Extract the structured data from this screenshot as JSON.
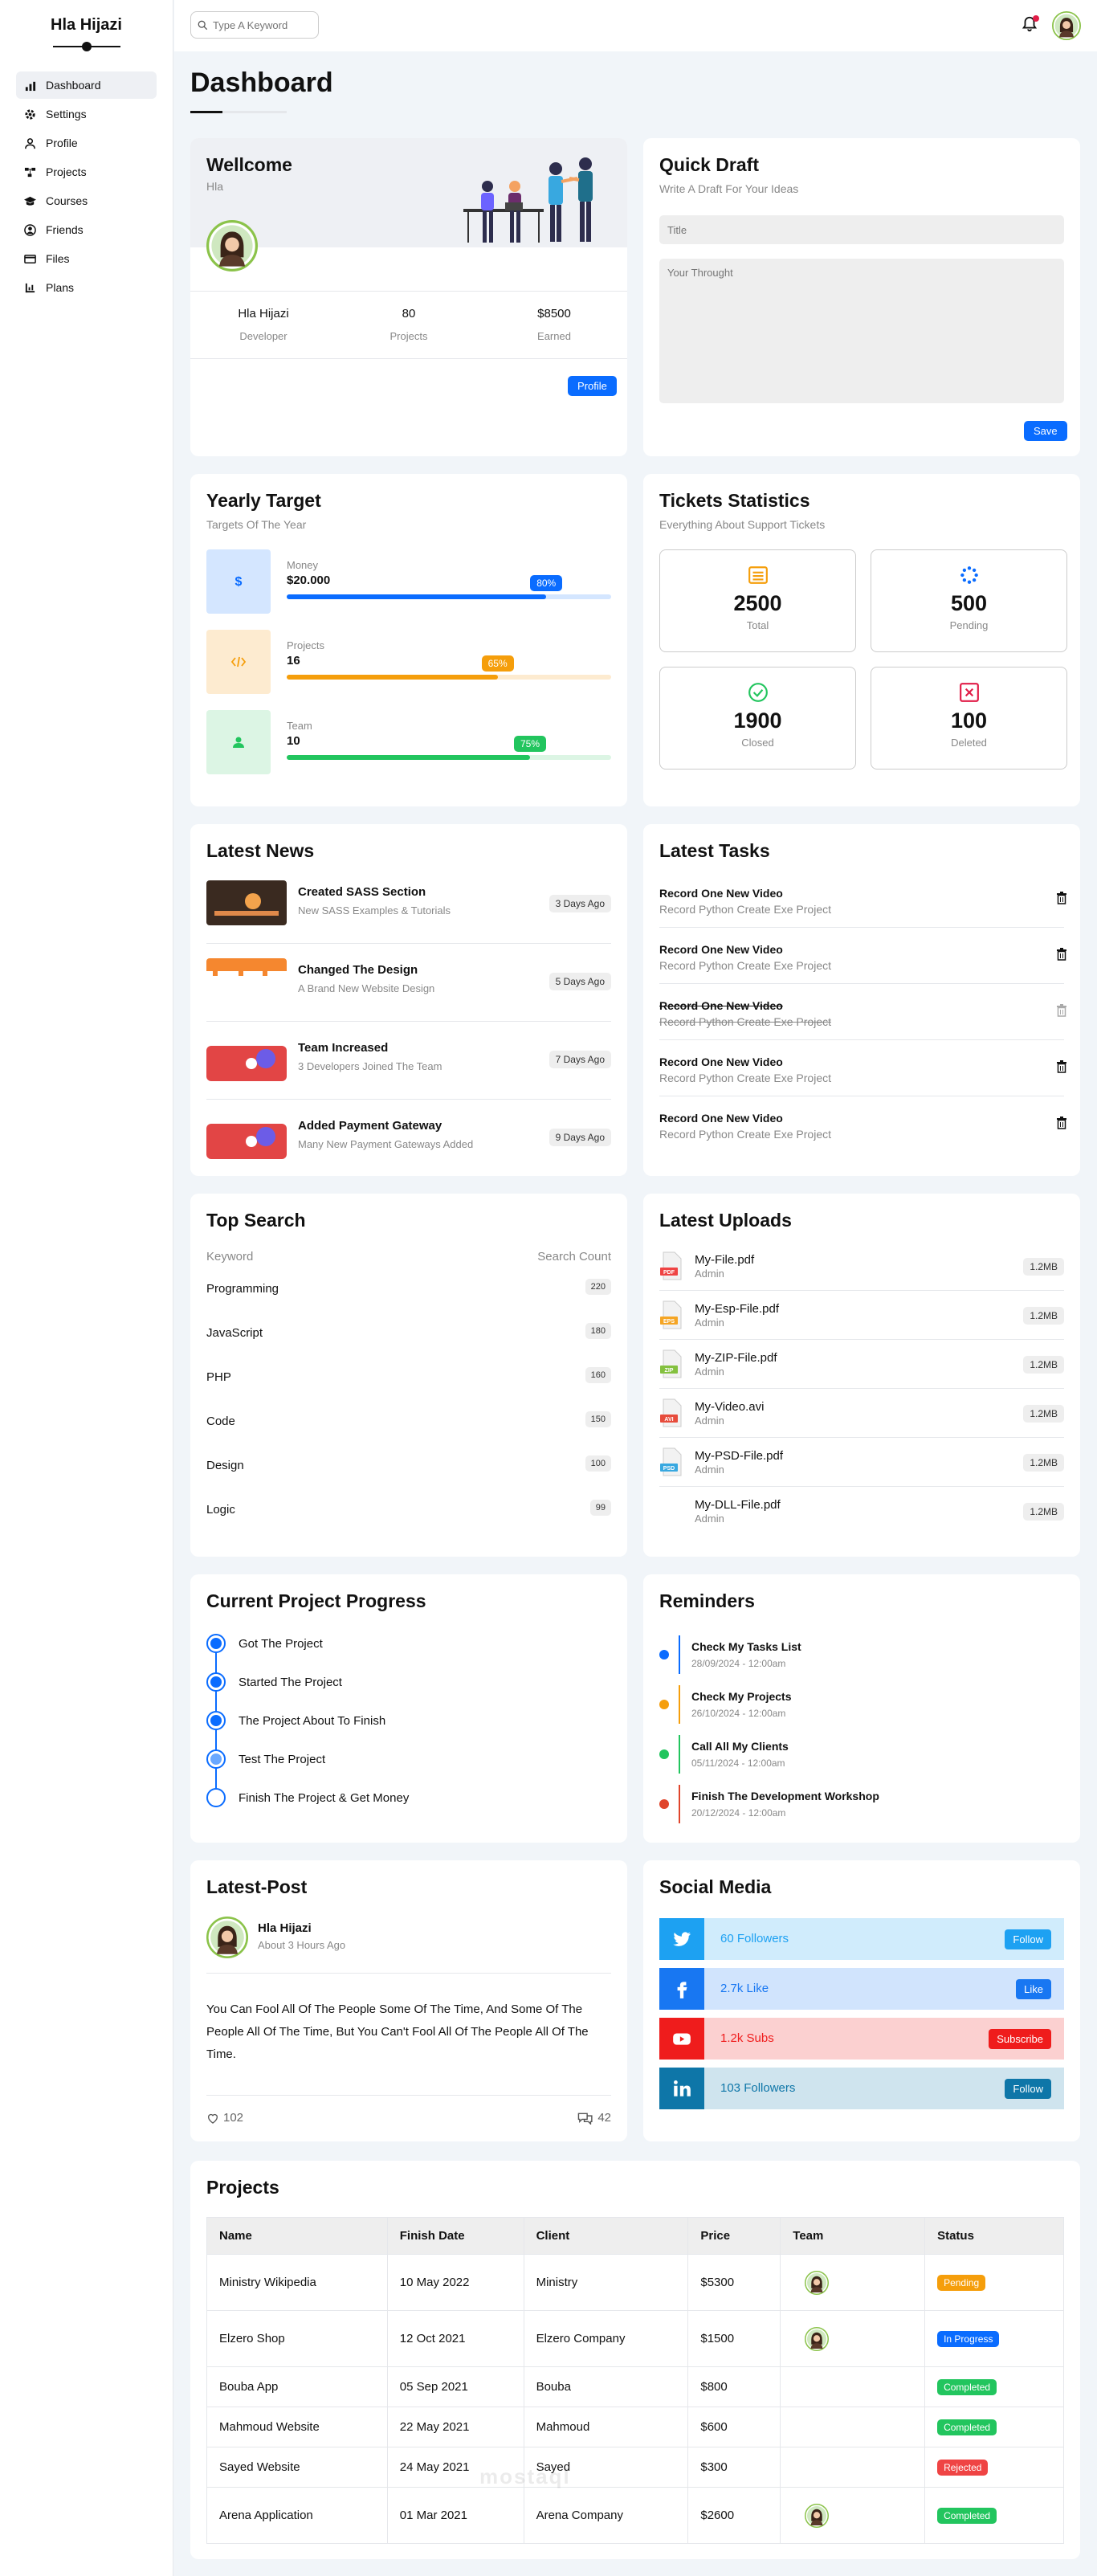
{
  "sidebar": {
    "brand": "Hla Hijazi",
    "items": [
      {
        "label": "Dashboard",
        "icon": "chart-icon",
        "active": true
      },
      {
        "label": "Settings",
        "icon": "gear-icon"
      },
      {
        "label": "Profile",
        "icon": "user-icon"
      },
      {
        "label": "Projects",
        "icon": "diagram-icon"
      },
      {
        "label": "Courses",
        "icon": "graduation-cap-icon"
      },
      {
        "label": "Friends",
        "icon": "user-circle-icon"
      },
      {
        "label": "Files",
        "icon": "file-icon"
      },
      {
        "label": "Plans",
        "icon": "plans-icon"
      }
    ]
  },
  "topbar": {
    "search_placeholder": "Type A Keyword"
  },
  "page": {
    "title": "Dashboard"
  },
  "welcome": {
    "title": "Wellcome",
    "name": "Hla",
    "stats": [
      {
        "value": "Hla Hijazi",
        "label": "Developer"
      },
      {
        "value": "80",
        "label": "Projects"
      },
      {
        "value": "$8500",
        "label": "Earned"
      }
    ],
    "button": "Profile"
  },
  "quick_draft": {
    "title": "Quick Draft",
    "subtitle": "Write A Draft For Your Ideas",
    "title_placeholder": "Title",
    "body_placeholder": "Your Throught",
    "button": "Save"
  },
  "yearly_target": {
    "title": "Yearly Target",
    "subtitle": "Targets Of The Year",
    "items": [
      {
        "label": "Money",
        "value": "$20.000",
        "percent_label": "80%",
        "percent": 80,
        "color": "#0a6cff",
        "bg": "#d4e6ff",
        "icon": "dollar-icon"
      },
      {
        "label": "Projects",
        "value": "16",
        "percent_label": "65%",
        "percent": 65,
        "color": "#f59e0b",
        "bg": "#fdebd0",
        "icon": "code-icon"
      },
      {
        "label": "Team",
        "value": "10",
        "percent_label": "75%",
        "percent": 75,
        "color": "#22c55e",
        "bg": "#dcf5e4",
        "icon": "user-icon"
      }
    ]
  },
  "tickets": {
    "title": "Tickets Statistics",
    "subtitle": "Everything About Support Tickets",
    "items": [
      {
        "value": "2500",
        "label": "Total",
        "color": "#f59e0b",
        "icon": "list-icon"
      },
      {
        "value": "500",
        "label": "Pending",
        "color": "#0a6cff",
        "icon": "spinner-icon"
      },
      {
        "value": "1900",
        "label": "Closed",
        "color": "#22c55e",
        "icon": "check-circle-icon"
      },
      {
        "value": "100",
        "label": "Deleted",
        "color": "#e11d48",
        "icon": "close-square-icon"
      }
    ]
  },
  "news": {
    "title": "Latest News",
    "items": [
      {
        "title": "Created SASS Section",
        "desc": "New SASS Examples & Tutorials",
        "date": "3 Days Ago"
      },
      {
        "title": "Changed The Design",
        "desc": "A Brand New Website Design",
        "date": "5 Days Ago"
      },
      {
        "title": "Team Increased",
        "desc": "3 Developers Joined The Team",
        "date": "7 Days Ago"
      },
      {
        "title": "Added Payment Gateway",
        "desc": "Many New Payment Gateways Added",
        "date": "9 Days Ago"
      }
    ]
  },
  "tasks": {
    "title": "Latest Tasks",
    "items": [
      {
        "title": "Record One New Video",
        "desc": "Record Python Create Exe Project",
        "done": false
      },
      {
        "title": "Record One New Video",
        "desc": "Record Python Create Exe Project",
        "done": false
      },
      {
        "title": "Record One New Video",
        "desc": "Record Python Create Exe Project",
        "done": true
      },
      {
        "title": "Record One New Video",
        "desc": "Record Python Create Exe Project",
        "done": false
      },
      {
        "title": "Record One New Video",
        "desc": "Record Python Create Exe Project",
        "done": false
      }
    ]
  },
  "top_search": {
    "title": "Top Search",
    "col_keyword": "Keyword",
    "col_count": "Search Count",
    "rows": [
      {
        "keyword": "Programming",
        "count": "220"
      },
      {
        "keyword": "JavaScript",
        "count": "180"
      },
      {
        "keyword": "PHP",
        "count": "160"
      },
      {
        "keyword": "Code",
        "count": "150"
      },
      {
        "keyword": "Design",
        "count": "100"
      },
      {
        "keyword": "Logic",
        "count": "99"
      }
    ]
  },
  "uploads": {
    "title": "Latest Uploads",
    "items": [
      {
        "name": "My-File.pdf",
        "by": "Admin",
        "size": "1.2MB",
        "ext": "PDF",
        "color": "#ef4444"
      },
      {
        "name": "My-Esp-File.pdf",
        "by": "Admin",
        "size": "1.2MB",
        "ext": "EPS",
        "color": "#f5a524"
      },
      {
        "name": "My-ZIP-File.pdf",
        "by": "Admin",
        "size": "1.2MB",
        "ext": "ZIP",
        "color": "#84c13f"
      },
      {
        "name": "My-Video.avi",
        "by": "Admin",
        "size": "1.2MB",
        "ext": "AVI",
        "color": "#e74c3c"
      },
      {
        "name": "My-PSD-File.pdf",
        "by": "Admin",
        "size": "1.2MB",
        "ext": "PSD",
        "color": "#38a8e0"
      },
      {
        "name": "My-DLL-File.pdf",
        "by": "Admin",
        "size": "1.2MB",
        "ext": "",
        "color": ""
      }
    ]
  },
  "progress": {
    "title": "Current Project Progress",
    "steps": [
      {
        "label": "Got The Project",
        "state": "done"
      },
      {
        "label": "Started The Project",
        "state": "done"
      },
      {
        "label": "The Project About To Finish",
        "state": "done"
      },
      {
        "label": "Test The Project",
        "state": "current"
      },
      {
        "label": "Finish The Project & Get Money",
        "state": "todo"
      }
    ]
  },
  "reminders": {
    "title": "Reminders",
    "items": [
      {
        "title": "Check My Tasks List",
        "date": "28/09/2024 - 12:00am",
        "color": "#0a6cff"
      },
      {
        "title": "Check My Projects",
        "date": "26/10/2024 - 12:00am",
        "color": "#f59e0b"
      },
      {
        "title": "Call All My Clients",
        "date": "05/11/2024 - 12:00am",
        "color": "#22c55e"
      },
      {
        "title": "Finish The Development Workshop",
        "date": "20/12/2024 - 12:00am",
        "color": "#e0452c"
      }
    ]
  },
  "post": {
    "title": "Latest-Post",
    "author": "Hla Hijazi",
    "time": "About 3 Hours Ago",
    "text": "You Can Fool All Of The People Some Of The Time, And Some Of The People All Of The Time, But You Can't Fool All Of The People All Of The Time.",
    "likes": "102",
    "comments": "42"
  },
  "social": {
    "title": "Social Media",
    "items": [
      {
        "text": "60 Followers",
        "button": "Follow",
        "icon": "twitter-icon",
        "color": "#1da1f2",
        "bg": "#d0ecfc",
        "btn": "#1da1f2"
      },
      {
        "text": "2.7k Like",
        "button": "Like",
        "icon": "facebook-icon",
        "color": "#1877f2",
        "bg": "#d1e4fd",
        "btn": "#1877f2"
      },
      {
        "text": "1.2k Subs",
        "button": "Subscribe",
        "icon": "youtube-icon",
        "color": "#ef1c1c",
        "bg": "#fbd0d0",
        "btn": "#ef1c1c"
      },
      {
        "text": "103 Followers",
        "button": "Follow",
        "icon": "linkedin-icon",
        "color": "#0e76a8",
        "bg": "#cfe4ee",
        "btn": "#0e76a8"
      }
    ]
  },
  "projects": {
    "title": "Projects",
    "headers": [
      "Name",
      "Finish Date",
      "Client",
      "Price",
      "Team",
      "Status"
    ],
    "rows": [
      {
        "name": "Ministry Wikipedia",
        "date": "10 May 2022",
        "client": "Ministry",
        "price": "$5300",
        "team": true,
        "status": "Pending",
        "status_color": "#f59e0b"
      },
      {
        "name": "Elzero Shop",
        "date": "12 Oct 2021",
        "client": "Elzero Company",
        "price": "$1500",
        "team": true,
        "status": "In Progress",
        "status_color": "#0a6cff"
      },
      {
        "name": "Bouba App",
        "date": "05 Sep 2021",
        "client": "Bouba",
        "price": "$800",
        "team": false,
        "status": "Completed",
        "status_color": "#22c55e"
      },
      {
        "name": "Mahmoud Website",
        "date": "22 May 2021",
        "client": "Mahmoud",
        "price": "$600",
        "team": false,
        "status": "Completed",
        "status_color": "#22c55e"
      },
      {
        "name": "Sayed Website",
        "date": "24 May 2021",
        "client": "Sayed",
        "price": "$300",
        "team": false,
        "status": "Rejected",
        "status_color": "#ef4444"
      },
      {
        "name": "Arena Application",
        "date": "01 Mar 2021",
        "client": "Arena Company",
        "price": "$2600",
        "team": true,
        "status": "Completed",
        "status_color": "#22c55e"
      }
    ]
  },
  "watermark": "mostaql"
}
